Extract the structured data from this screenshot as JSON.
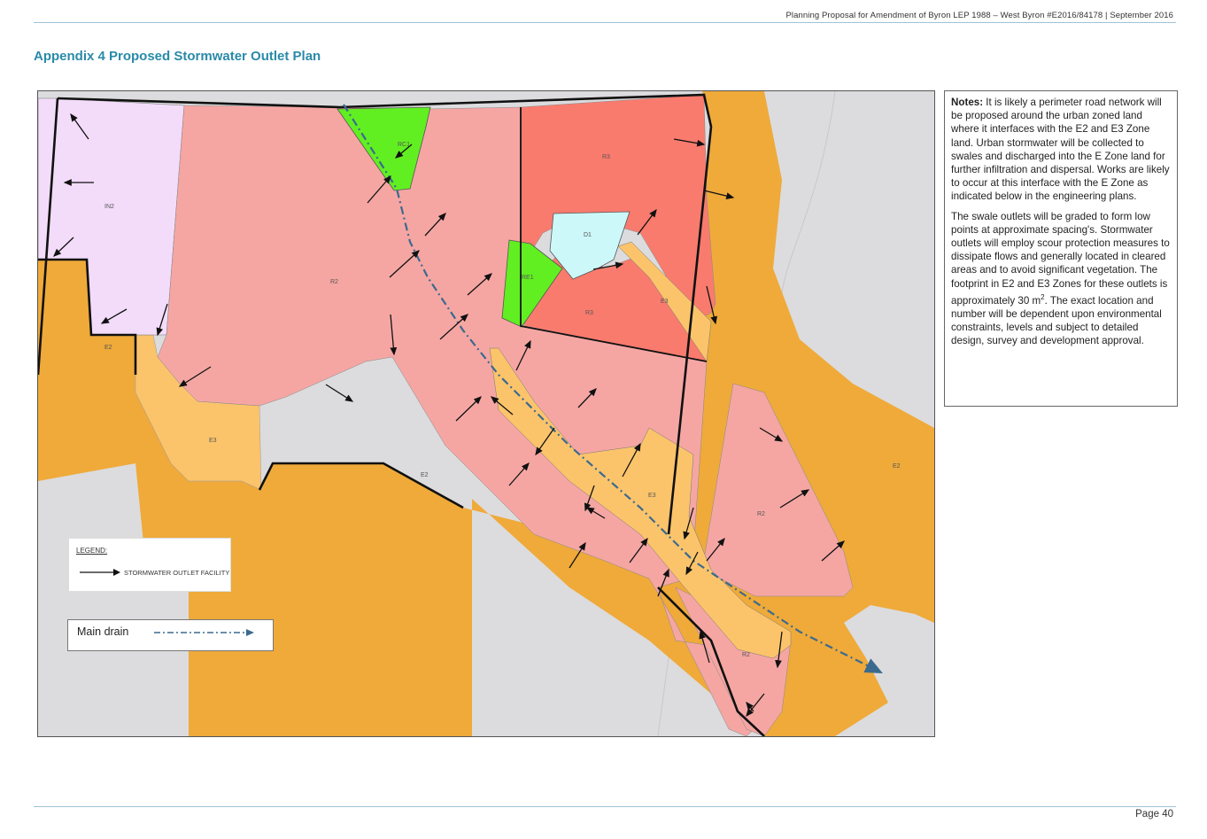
{
  "header": {
    "text": "Planning Proposal for Amendment of Byron LEP 1988 – West Byron #E2016/84178 | September 2016"
  },
  "page_title": "Appendix 4 Proposed Stormwater Outlet Plan",
  "notes": {
    "lead": "Notes:",
    "para1": " It is likely a perimeter road network will be proposed around the urban zoned land where it interfaces with the E2 and E3 Zone land. Urban stormwater will be collected to swales and discharged into the E Zone land for further infiltration and dispersal. Works are likely to occur at this interface with the E Zone as indicated below in the engineering plans.",
    "para2_a": "The swale outlets will be graded to form low points at approximate spacing's. Stormwater outlets will employ scour protection measures to dissipate flows and generally located in cleared areas and to avoid significant vegetation. The footprint in E2 and E3 Zones for these outlets is approximately 30 m",
    "para2_sup": "2",
    "para2_b": ". The exact location and number will be dependent upon environmental constraints, levels and subject to detailed design, survey and development approval."
  },
  "legend": {
    "title": "LEGEND:",
    "item": "STORMWATER OUTLET FACILITY"
  },
  "drain_legend": {
    "label": "Main drain"
  },
  "zones": {
    "in2": "IN2",
    "r2_a": "R2",
    "r2_b": "R2",
    "r2_c": "R2",
    "r2_d": "R2",
    "r3_a": "R3",
    "r3_b": "R3",
    "d1": "D1",
    "re1": "RE1",
    "rc1": "RC1",
    "e3_a": "E3",
    "e3_b": "E3",
    "e3_c": "E3",
    "e2_a": "E2",
    "e2_b": "E2",
    "e2_c": "E2"
  },
  "colors": {
    "e2": "#efaa3a",
    "e3": "#fbc46b",
    "r2": "#f5a6a3",
    "r3": "#f97b6e",
    "in2": "#f3dcfa",
    "re1": "#61ef21",
    "d1": "#cdf8fa",
    "drain": "#3b6a8e",
    "title": "#2a8aa8"
  },
  "footer": {
    "page": "Page 40"
  }
}
